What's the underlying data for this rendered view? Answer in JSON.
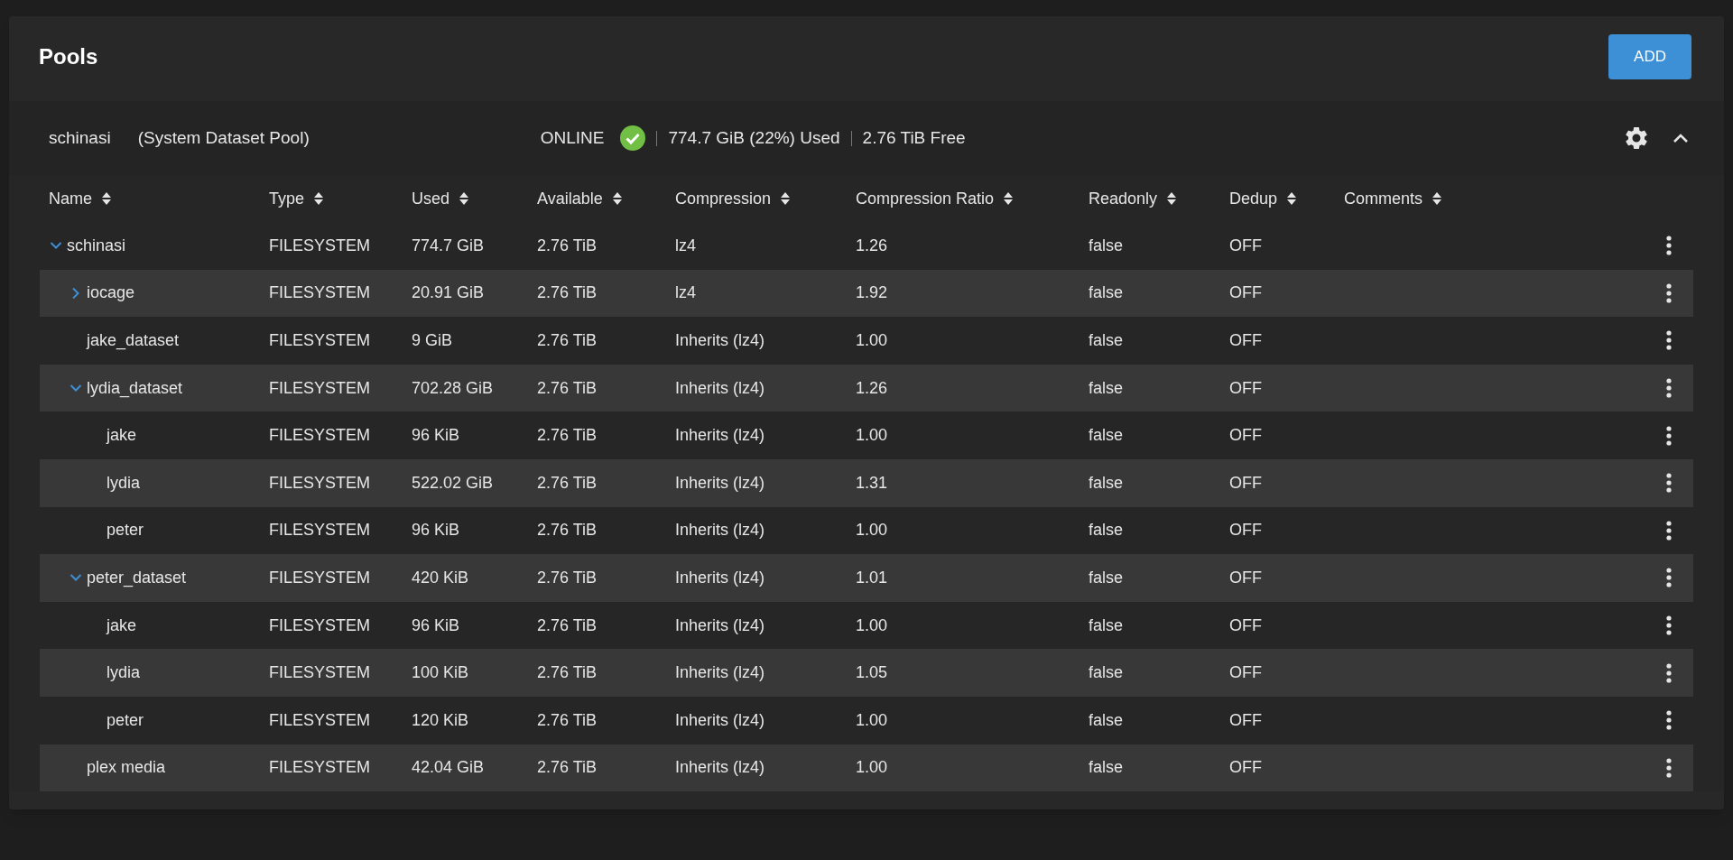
{
  "page": {
    "title": "Pools",
    "add_button": "ADD"
  },
  "pool": {
    "name": "schinasi",
    "role": "(System Dataset Pool)",
    "status": "ONLINE",
    "used": "774.7 GiB (22%) Used",
    "free": "2.76 TiB Free",
    "expanded": true,
    "columns": [
      "Name",
      "Type",
      "Used",
      "Available",
      "Compression",
      "Compression Ratio",
      "Readonly",
      "Dedup",
      "Comments"
    ],
    "rows": [
      {
        "cells": [
          "schinasi",
          "FILESYSTEM",
          "774.7 GiB",
          "2.76 TiB",
          "lz4",
          "1.26",
          "false",
          "OFF"
        ],
        "expanded": true,
        "children": [
          {
            "cells": [
              "iocage",
              "FILESYSTEM",
              "20.91 GiB",
              "2.76 TiB",
              "lz4",
              "1.92",
              "false",
              "OFF"
            ],
            "expanded": false
          },
          {
            "cells": [
              "jake_dataset",
              "FILESYSTEM",
              "9 GiB",
              "2.76 TiB",
              "Inherits (lz4)",
              "1.00",
              "false",
              "OFF"
            ]
          },
          {
            "cells": [
              "lydia_dataset",
              "FILESYSTEM",
              "702.28 GiB",
              "2.76 TiB",
              "Inherits (lz4)",
              "1.26",
              "false",
              "OFF"
            ],
            "expanded": true,
            "children": [
              {
                "cells": [
                  "jake",
                  "FILESYSTEM",
                  "96 KiB",
                  "2.76 TiB",
                  "Inherits (lz4)",
                  "1.00",
                  "false",
                  "OFF"
                ]
              },
              {
                "cells": [
                  "lydia",
                  "FILESYSTEM",
                  "522.02 GiB",
                  "2.76 TiB",
                  "Inherits (lz4)",
                  "1.31",
                  "false",
                  "OFF"
                ]
              },
              {
                "cells": [
                  "peter",
                  "FILESYSTEM",
                  "96 KiB",
                  "2.76 TiB",
                  "Inherits (lz4)",
                  "1.00",
                  "false",
                  "OFF"
                ]
              }
            ]
          },
          {
            "cells": [
              "peter_dataset",
              "FILESYSTEM",
              "420 KiB",
              "2.76 TiB",
              "Inherits (lz4)",
              "1.01",
              "false",
              "OFF"
            ],
            "expanded": true,
            "children": [
              {
                "cells": [
                  "jake",
                  "FILESYSTEM",
                  "96 KiB",
                  "2.76 TiB",
                  "Inherits (lz4)",
                  "1.00",
                  "false",
                  "OFF"
                ]
              },
              {
                "cells": [
                  "lydia",
                  "FILESYSTEM",
                  "100 KiB",
                  "2.76 TiB",
                  "Inherits (lz4)",
                  "1.05",
                  "false",
                  "OFF"
                ]
              },
              {
                "cells": [
                  "peter",
                  "FILESYSTEM",
                  "120 KiB",
                  "2.76 TiB",
                  "Inherits (lz4)",
                  "1.00",
                  "false",
                  "OFF"
                ]
              }
            ]
          },
          {
            "cells": [
              "plex media",
              "FILESYSTEM",
              "42.04 GiB",
              "2.76 TiB",
              "Inherits (lz4)",
              "1.00",
              "false",
              "OFF"
            ]
          }
        ]
      }
    ]
  }
}
